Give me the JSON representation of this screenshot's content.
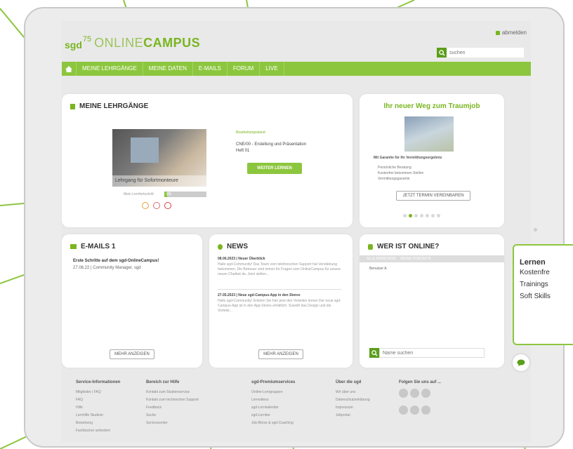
{
  "header": {
    "logo_sgd": "sgd",
    "logo_num": "75",
    "logo_online": "ONLINE",
    "logo_campus": "CAMPUS",
    "logout": "abmelden",
    "search_placeholder": "suchen"
  },
  "nav": {
    "items": [
      "MEINE LEHRGÄNGE",
      "MEINE DATEN",
      "E-MAILS",
      "FORUM",
      "LIVE"
    ]
  },
  "lehrgaenge": {
    "title": "MEINE LEHRGÄNGE",
    "image_caption": "Lehrgang für Sofortmonteure",
    "progress_label": "Mein Lernfortschritt",
    "progress_value": "6%",
    "progress": 0.06,
    "section_label": "Bearbeitungsstand",
    "course_line": "CNE/00 - Erstellung und Präsentation",
    "course_sub": "Heft 01",
    "button": "WEITER LERNEN"
  },
  "traumjob": {
    "title": "Ihr neuer Weg zum Traumjob",
    "subtitle": "Mit Garantie für Ihr Vermittlungsergebnis",
    "bullets": [
      "Persönliche Beratung",
      "Kostenfrei bekommen Stellen",
      "Vermittlungsgarantie"
    ],
    "button": "JETZT TERMIN VEREINBAREN",
    "dots": 7,
    "active_dot": 1
  },
  "emails": {
    "title": "E-MAILS 1",
    "subject": "Erste Schritte auf dem sgd-OnlineCampus!",
    "meta": "27.08.22 | Community Manager, sgd",
    "button": "MEHR ANZEIGEN"
  },
  "news": {
    "title": "NEWS",
    "items": [
      {
        "date": "08.06.2023 | Neuer Überblick",
        "text": "Hallo sgd-Community! Das Team vom telefonischen Support hat Verstärkung bekommen. Die Betreuer sind immer für Fragen zum OnlineCampus für unsere neuen Chatbot da. Jetzt stellen..."
      },
      {
        "date": "27.05.2023 | Neue sgd-Campus-App in den Stores",
        "text": "Hallo sgd-Community! Erleben Sie hier jetzt den Vorteilen lernen Der neue sgd-Campus-App ist in den App-Stores erhältlich. Sowohl das Design und die Vorteile..."
      }
    ],
    "button": "MEHR ANZEIGEN"
  },
  "online": {
    "title": "WER IST ONLINE?",
    "tabs": [
      "ALLE ANWESEND",
      "MEINE KONTAKTE"
    ],
    "user": "Benutzer A",
    "search_placeholder": "Name suchen"
  },
  "footer": {
    "cols": [
      {
        "head": "Service-Informationen",
        "links": [
          "Mitglieder | FAQ",
          "FAQ",
          "Hilfe",
          "Lernhilfe Studium",
          "Bewertung",
          "Fachbücher anfordern"
        ]
      },
      {
        "head": "Bereich zur Hilfe",
        "links": [
          "Kontakt zum Studienservice",
          "Kontakt zum technischen Support",
          "Feedback",
          "Suche",
          "Servicecenter"
        ]
      },
      {
        "head": "sgd-Premiumservices",
        "links": [
          "Online-Lerngruppen",
          "Lernvideos",
          "sgd-Lernkalender",
          "sgd-Lernfee",
          "Job-Börse & sgd-Coaching"
        ]
      },
      {
        "head": "Über die sgd",
        "links": [
          "Wir über uns",
          "Datenschutzerklärung",
          "Impressum",
          "Jobportal"
        ]
      },
      {
        "head": "Folgen Sie uns auf ...",
        "links": []
      }
    ]
  },
  "promo": {
    "title": "Lernen",
    "lines": [
      "Kostenfre",
      "Trainings",
      "Soft Skills"
    ]
  },
  "colors": {
    "accent": "#8cc63e",
    "accent_dark": "#7ab520",
    "background": "#e9e9e9"
  },
  "icons": [
    "home-icon",
    "search-icon",
    "lock-icon",
    "book-icon",
    "mail-icon",
    "news-icon",
    "users-icon",
    "chat-icon",
    "social-icon"
  ]
}
